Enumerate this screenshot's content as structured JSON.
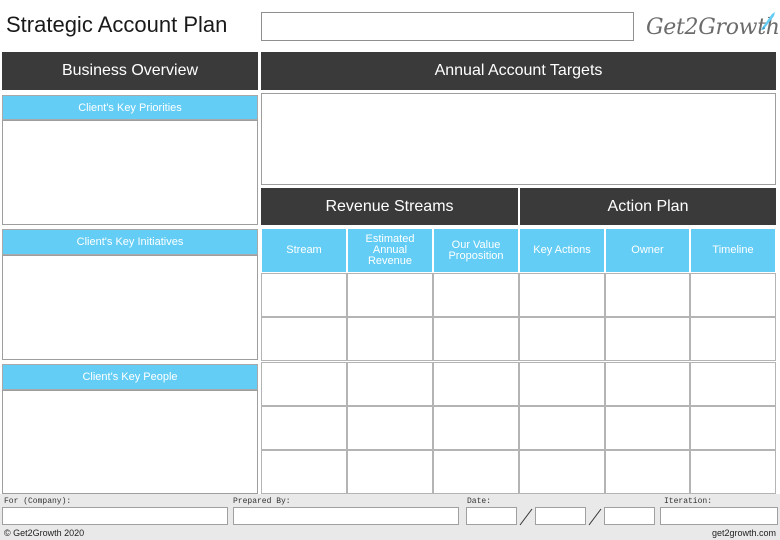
{
  "header": {
    "title": "Strategic Account Plan",
    "title_input_value": "",
    "logo_text": "Get2Growth",
    "logo_icon": "rocket-icon"
  },
  "left": {
    "business_overview": "Business Overview",
    "key_priorities_label": "Client's Key Priorities",
    "key_initiatives_label": "Client's Key Initiatives",
    "key_people_label": "Client's Key People"
  },
  "right": {
    "annual_targets": "Annual Account Targets",
    "revenue_streams": "Revenue Streams",
    "action_plan": "Action Plan",
    "columns": [
      "Stream",
      "Estimated Annual Revenue",
      "Our Value Proposition",
      "Key Actions",
      "Owner",
      "Timeline"
    ]
  },
  "footer": {
    "for_company_label": "For (Company):",
    "prepared_by_label": "Prepared By:",
    "date_label": "Date:",
    "iteration_label": "Iteration:",
    "copyright": "© Get2Growth 2020",
    "website": "get2growth.com"
  },
  "colors": {
    "dark_header": "#3a3a3a",
    "accent_blue": "#63cdf6",
    "footer_bg": "#e9e9e9"
  }
}
